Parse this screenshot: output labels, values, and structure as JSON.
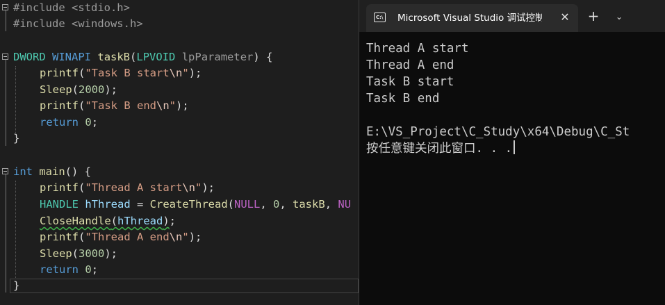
{
  "editor": {
    "include1": "#include <stdio.h>",
    "include2": "#include <windows.h>",
    "l4": {
      "type": "DWORD",
      "conv": "WINAPI",
      "name": "taskB",
      "po": "(",
      "ptype": "LPVOID",
      "pname": "lpParameter",
      "rest": ") {"
    },
    "l5": {
      "fn": "printf",
      "open": "(",
      "str": "\"Task B start",
      "esc": "\\n",
      "q": "\"",
      "end": ");"
    },
    "l6": {
      "fn": "Sleep",
      "open": "(",
      "num": "2000",
      "end": ");"
    },
    "l7": {
      "fn": "printf",
      "open": "(",
      "str": "\"Task B end",
      "esc": "\\n",
      "q": "\"",
      "end": ");"
    },
    "l8": {
      "kw": "return",
      "num": "0",
      "end": ";"
    },
    "l9": "}",
    "l11": {
      "type": "int",
      "name": "main",
      "rest": "() {"
    },
    "l12": {
      "fn": "printf",
      "open": "(",
      "str": "\"Thread A start",
      "esc": "\\n",
      "q": "\"",
      "end": ");"
    },
    "l13": {
      "type": "HANDLE",
      "var": "hThread",
      "eq": " = ",
      "fn": "CreateThread",
      "open": "(",
      "m1": "NULL",
      "c1": ", ",
      "n1": "0",
      "c2": ", ",
      "arg": "taskB",
      "c3": ", ",
      "m2": "NU"
    },
    "l14": {
      "fn": "CloseHandle",
      "open": "(",
      "var": "hThread",
      "close": ")",
      "end": ";"
    },
    "l15": {
      "fn": "printf",
      "open": "(",
      "str": "\"Thread A end",
      "esc": "\\n",
      "q": "\"",
      "end": ");"
    },
    "l16": {
      "fn": "Sleep",
      "open": "(",
      "num": "3000",
      "end": ");"
    },
    "l17": {
      "kw": "return",
      "num": "0",
      "end": ";"
    },
    "l18": "}"
  },
  "console": {
    "tab_title": "Microsoft Visual Studio 调试控制台",
    "tab_icon_text": "C:\\",
    "close_glyph": "✕",
    "new_tab_glyph": "+",
    "menu_glyph": "⌄",
    "lines": [
      "Thread A start",
      "Thread A end",
      "Task B start",
      "Task B end",
      "",
      "E:\\VS_Project\\C_Study\\x64\\Debug\\C_St",
      "按任意键关闭此窗口. . ."
    ]
  },
  "colors": {
    "editor_bg": "#1e1e1e",
    "console_bg": "#0c0c0c",
    "keyword": "#569cd6",
    "type": "#4ec9b0",
    "function": "#dcdcaa",
    "string": "#d69d85",
    "number": "#b5cea8",
    "macro": "#bd63c5",
    "variable": "#9cdcfe"
  }
}
